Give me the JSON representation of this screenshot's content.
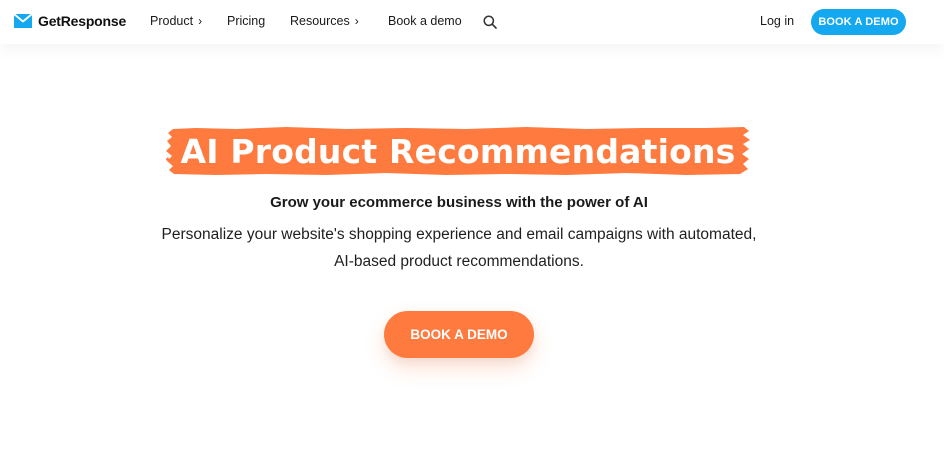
{
  "header": {
    "logo_text": "GetResponse",
    "nav": [
      {
        "label": "Product",
        "has_chevron": true
      },
      {
        "label": "Pricing",
        "has_chevron": false
      },
      {
        "label": "Resources",
        "has_chevron": true
      },
      {
        "label": "Book a demo",
        "has_chevron": false
      }
    ],
    "chevron_glyph": "›",
    "search_icon": "search-icon",
    "login_label": "Log in",
    "cta_label": "BOOK A DEMO"
  },
  "hero": {
    "title": "AI Product Recommendations",
    "subtitle": "Grow your ecommerce business with the power of AI",
    "description_lines": [
      "Personalize your website's shopping experience and email campaigns with automated,",
      "AI-based product recommendations."
    ],
    "cta_label": "BOOK A DEMO"
  },
  "colors": {
    "brand_blue": "#13a8f0",
    "accent_orange": "#ff7a3e",
    "text": "#1a1a1a",
    "background": "#ffffff"
  }
}
